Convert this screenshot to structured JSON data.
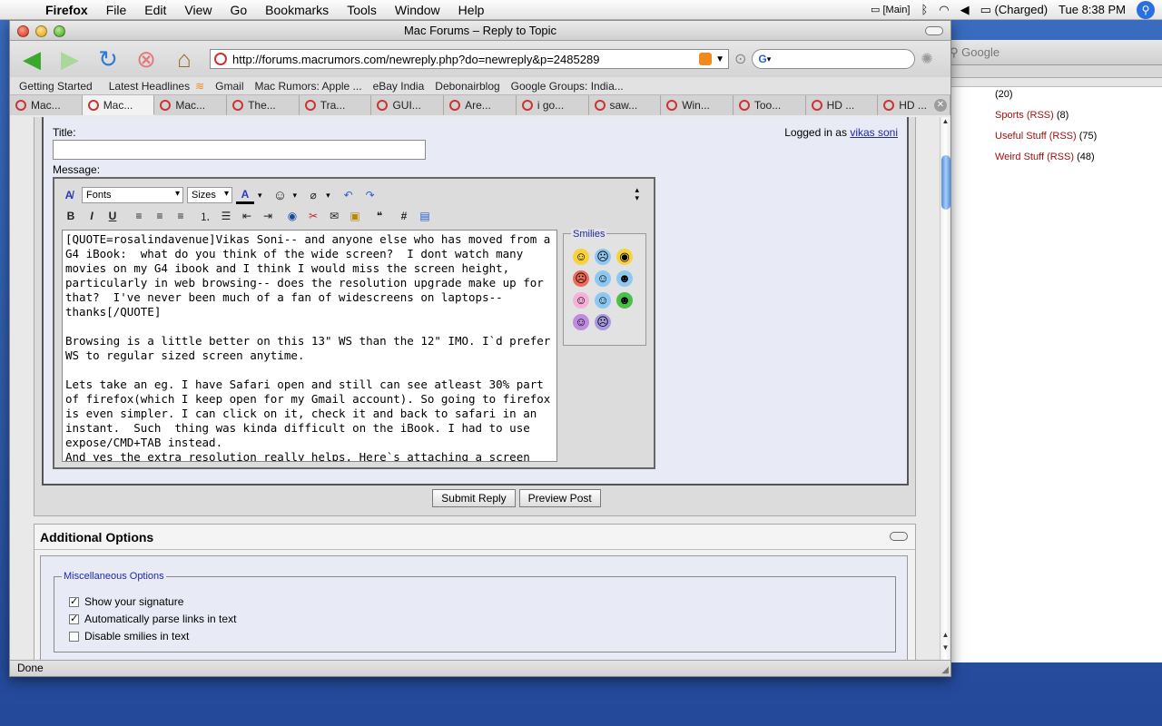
{
  "menubar": {
    "app": "Firefox",
    "items": [
      "File",
      "Edit",
      "View",
      "Go",
      "Bookmarks",
      "Tools",
      "Window",
      "Help"
    ],
    "status": {
      "main": "[Main]",
      "battery": "(Charged)",
      "clock": "Tue 8:38 PM"
    }
  },
  "bg_window": {
    "search_placeholder": "Google",
    "items": [
      {
        "label": "",
        "count": "(20)"
      },
      {
        "label": "Sports",
        "rss": "(RSS)",
        "count": "(8)"
      },
      {
        "label": "Useful Stuff",
        "rss": "(RSS)",
        "count": "(75)"
      },
      {
        "label": "Weird Stuff",
        "rss": "(RSS)",
        "count": "(48)"
      }
    ]
  },
  "window": {
    "title": "Mac Forums – Reply to Topic",
    "url": "http://forums.macrumors.com/newreply.php?do=newreply&p=2485289",
    "bookmarks": [
      "Getting Started",
      "Latest Headlines",
      "Gmail",
      "Mac Rumors: Apple ...",
      "eBay India",
      "Debonairblog",
      "Google Groups: India..."
    ],
    "tabs": [
      "Mac...",
      "Mac...",
      "Mac...",
      "The...",
      "Tra...",
      "GUI...",
      "Are...",
      "i go...",
      "saw...",
      "Win...",
      "Too...",
      "HD ...",
      "HD ..."
    ],
    "active_tab": 1,
    "status": "Done"
  },
  "form": {
    "title_label": "Title:",
    "logged_in_prefix": "Logged in as",
    "username": "vikas soni",
    "message_label": "Message:",
    "fonts_select": "Fonts",
    "sizes_select": "Sizes",
    "message": "[QUOTE=rosalindavenue]Vikas Soni-- and anyone else who has moved from a G4 iBook:  what do you think of the wide screen?  I dont watch many movies on my G4 ibook and I think I would miss the screen height, particularly in web browsing-- does the resolution upgrade make up for that?  I've never been much of a fan of widescreens on laptops-- thanks[/QUOTE]\n\nBrowsing is a little better on this 13\" WS than the 12\" IMO. I`d prefer WS to regular sized screen anytime.\n\nLets take an eg. I have Safari open and still can see atleast 30% part of firefox(which I keep open for my Gmail account). So going to firefox is even simpler. I can click on it, check it and back to safari in an instant.  Such  thing was kinda difficult on the iBook. I had to use expose/CMD+TAB instead.\nAnd yes the extra resolution really helps. Here`s attaching a screen grab. See it for your self.",
    "smilies_legend": "Smilies",
    "submit": "Submit Reply",
    "preview": "Preview Post"
  },
  "additional": {
    "heading": "Additional Options",
    "legend": "Miscellaneous Options",
    "options": [
      {
        "label": "Show your signature",
        "checked": true
      },
      {
        "label": "Automatically parse links in text",
        "checked": true
      },
      {
        "label": "Disable smilies in text",
        "checked": false
      }
    ]
  },
  "colors": {
    "accent": "#1f2aa8",
    "link_red": "#a01010",
    "desktop": "#2d5aa8"
  }
}
